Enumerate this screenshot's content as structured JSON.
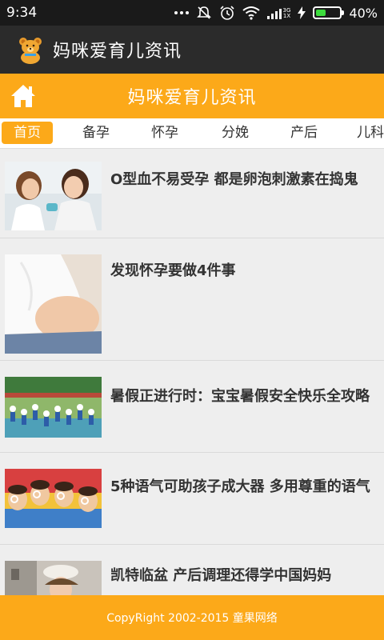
{
  "status_bar": {
    "time": "9:34",
    "network_type": "3G",
    "sim_label": "1X",
    "battery_percent": "40%",
    "battery_level": 0.4,
    "icons": [
      "more-dots-icon",
      "mute-icon",
      "alarm-icon",
      "wifi-icon",
      "signal-icon",
      "charging-icon",
      "battery-icon"
    ]
  },
  "app_bar": {
    "title": "妈咪爱育儿资讯",
    "logo_icon": "teddy-bear-icon"
  },
  "header": {
    "title": "妈咪爱育儿资讯",
    "home_icon": "home-icon"
  },
  "tabs": [
    {
      "label": "首页",
      "active": true
    },
    {
      "label": "备孕",
      "active": false
    },
    {
      "label": "怀孕",
      "active": false
    },
    {
      "label": "分娩",
      "active": false
    },
    {
      "label": "产后",
      "active": false
    },
    {
      "label": "儿科",
      "active": false
    }
  ],
  "articles": [
    {
      "title": "O型血不易受孕 都是卵泡刺激素在捣鬼"
    },
    {
      "title": "发现怀孕要做4件事"
    },
    {
      "title": "暑假正进行时：宝宝暑假安全快乐全攻略"
    },
    {
      "title": "5种语气可助孩子成大器 多用尊重的语气"
    },
    {
      "title": "凯特临盆 产后调理还得学中国妈妈"
    }
  ],
  "footer": {
    "text": "CopyRight 2002-2015 童果网络"
  },
  "colors": {
    "accent": "#fca919",
    "app_bar": "#2b2b2b",
    "status_bar": "#1a1a1a",
    "background": "#eeeeee"
  }
}
